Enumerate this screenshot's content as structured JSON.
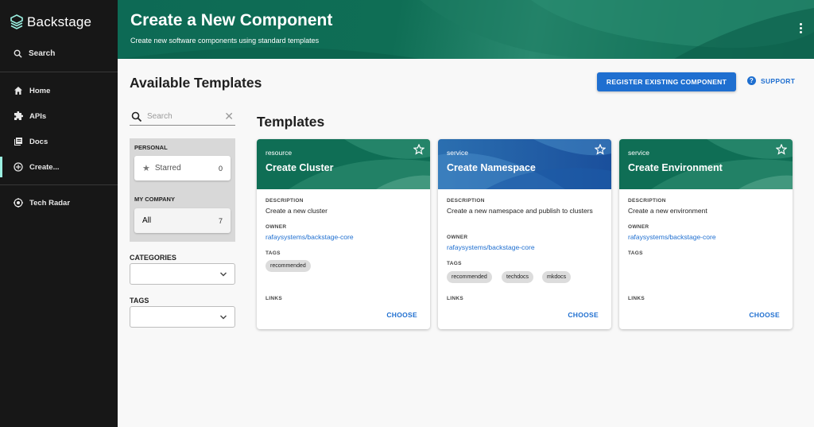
{
  "app": {
    "name": "Backstage"
  },
  "sidebar": {
    "search_label": "Search",
    "items": [
      {
        "label": "Home",
        "icon": "home-icon"
      },
      {
        "label": "APIs",
        "icon": "extension-icon"
      },
      {
        "label": "Docs",
        "icon": "library-books-icon"
      },
      {
        "label": "Create...",
        "icon": "add-circle-icon",
        "active": true
      },
      {
        "label": "Tech Radar",
        "icon": "radar-icon"
      }
    ]
  },
  "header": {
    "title": "Create a New Component",
    "subtitle": "Create new software components using standard templates"
  },
  "content": {
    "title": "Available Templates",
    "register_label": "REGISTER EXISTING COMPONENT",
    "support_label": "SUPPORT"
  },
  "filters": {
    "search_placeholder": "Search",
    "personal_label": "PERSONAL",
    "starred_label": "Starred",
    "starred_count": "0",
    "company_label": "MY COMPANY",
    "all_label": "All",
    "all_count": "7",
    "categories_label": "CATEGORIES",
    "tags_label": "TAGS"
  },
  "templates": {
    "heading": "Templates",
    "labels": {
      "description": "DESCRIPTION",
      "owner": "OWNER",
      "tags": "TAGS",
      "links": "LINKS",
      "choose": "CHOOSE"
    },
    "cards": [
      {
        "type": "resource",
        "name": "Create Cluster",
        "description": "Create a new cluster",
        "owner": "rafaysystems/backstage-core",
        "tags": [
          "recommended"
        ],
        "theme": "green"
      },
      {
        "type": "service",
        "name": "Create Namespace",
        "description": "Create a new namespace and publish to clusters",
        "owner": "rafaysystems/backstage-core",
        "tags": [
          "recommended",
          "techdocs",
          "mkdocs"
        ],
        "theme": "blue"
      },
      {
        "type": "service",
        "name": "Create Environment",
        "description": "Create a new environment",
        "owner": "rafaysystems/backstage-core",
        "tags": [],
        "theme": "green"
      }
    ]
  },
  "colors": {
    "sidebar_bg": "#171717",
    "header_green": "#0f6e55",
    "accent_blue": "#1f6fd0",
    "active_indicator": "#9bf0e1"
  }
}
